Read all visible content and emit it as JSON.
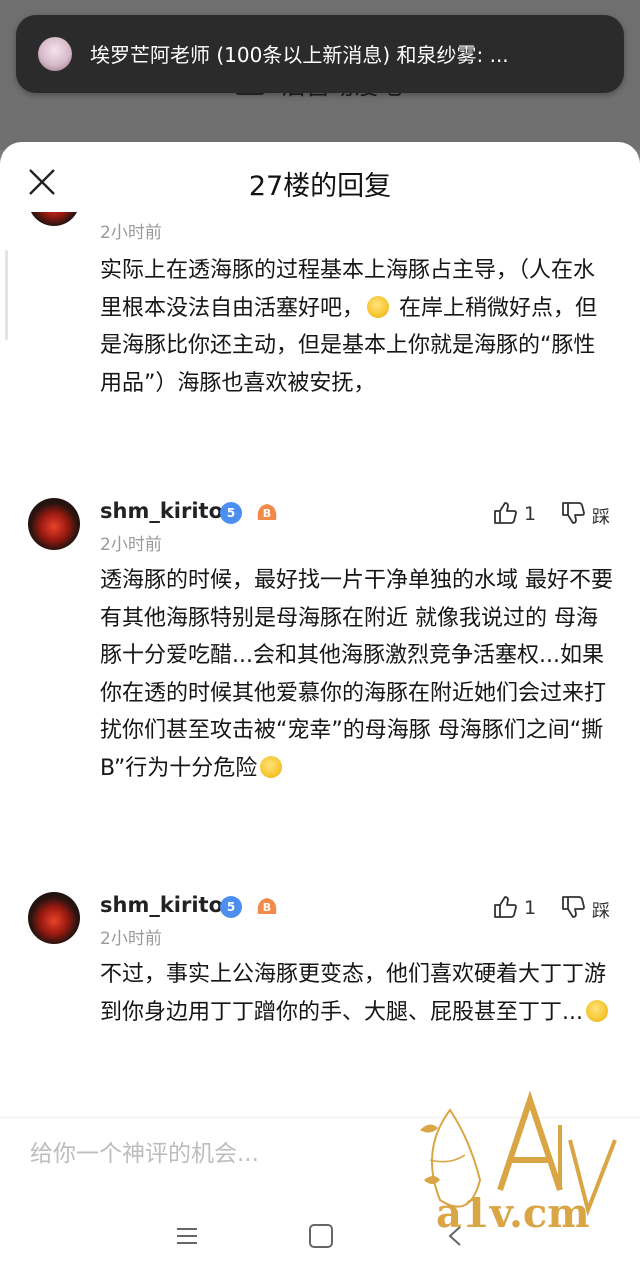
{
  "notification": {
    "text": "埃罗芒阿老师 (100条以上新消息) 和泉纱雾: ..."
  },
  "background": {
    "forum_title": "后宫动漫吧",
    "more_label": "···"
  },
  "sheet": {
    "title": "27楼的回复",
    "input_placeholder": "给你一个神评的机会..."
  },
  "replies": [
    {
      "time": "2小时前",
      "text_before": "实际上在透海豚的过程基本上海豚占主导，（人在水里根本没法自由活塞好吧，",
      "emoji": "thinking-emoji",
      "text_after": " 在岸上稍微好点，但是海豚比你还主动，但是基本上你就是海豚的“豚性用品”）海豚也喜欢被安抚，"
    },
    {
      "username": "shm_kirito",
      "level": "5",
      "badge": "B",
      "time": "2小时前",
      "likes": "1",
      "tread_label": "踩",
      "text_before": "透海豚的时候，最好找一片干净单独的水域 最好不要有其他海豚特别是母海豚在附近 就像我说过的 母海豚十分爱吃醋...会和其他海豚激烈竞争活塞权...如果你在透的时候其他爱慕你的海豚在附近她们会过来打扰你们甚至攻击被“宠幸”的母海豚 母海豚们之间“撕B”行为十分危险",
      "emoji": "sweat-emoji",
      "text_after": ""
    },
    {
      "username": "shm_kirito",
      "level": "5",
      "badge": "B",
      "time": "2小时前",
      "likes": "1",
      "tread_label": "踩",
      "text_before": "不过，事实上公海豚更变态，他们喜欢硬着大丁丁游到你身边用丁丁蹭你的手、大腿、屁股甚至丁丁...",
      "emoji": "smirk-emoji",
      "text_after": ""
    }
  ],
  "watermark": {
    "logo_text": "A1V",
    "site": "a1v.cm"
  },
  "colors": {
    "accent_blue": "#4d8ff0",
    "watermark_gold": "#d9a545",
    "time_gray": "#9a9a9a"
  }
}
